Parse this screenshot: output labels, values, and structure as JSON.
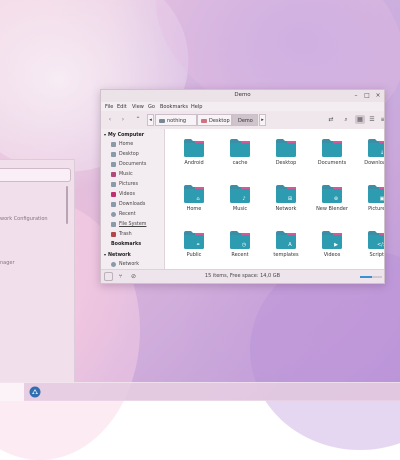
{
  "window": {
    "title": "Demo",
    "controls": {
      "minimize": "–",
      "maximize": "□",
      "close": "×"
    }
  },
  "menu": [
    "File",
    "Edit",
    "View",
    "Go",
    "Bookmarks",
    "Help"
  ],
  "breadcrumbs": [
    {
      "label": "nothing",
      "icon": "home-icon"
    },
    {
      "label": "Desktop",
      "icon": "desktop-icon"
    },
    {
      "label": "Demo",
      "icon": "folder-icon",
      "active": true
    }
  ],
  "sidebar": {
    "my_computer_label": "My Computer",
    "items": [
      {
        "label": "Home",
        "icon": "home-icon",
        "color": "#8a9aa8"
      },
      {
        "label": "Desktop",
        "icon": "desktop-icon",
        "color": "#8a9aa8"
      },
      {
        "label": "Documents",
        "icon": "documents-icon",
        "color": "#8a9aa8"
      },
      {
        "label": "Music",
        "icon": "music-icon",
        "color": "#b04a7a"
      },
      {
        "label": "Pictures",
        "icon": "pictures-icon",
        "color": "#8a9aa8"
      },
      {
        "label": "Videos",
        "icon": "videos-icon",
        "color": "#c03070"
      },
      {
        "label": "Downloads",
        "icon": "downloads-icon",
        "color": "#8a9aa8"
      },
      {
        "label": "Recent",
        "icon": "recent-icon",
        "color": "#8a9aa8"
      },
      {
        "label": "File System",
        "icon": "filesystem-icon",
        "color": "#8a9aa8"
      },
      {
        "label": "Trash",
        "icon": "trash-icon",
        "color": "#b04a4a"
      }
    ],
    "bookmarks_label": "Bookmarks",
    "network_label": "Network",
    "network_items": [
      {
        "label": "Network",
        "icon": "network-icon",
        "color": "#8a9aa8"
      }
    ]
  },
  "files": [
    {
      "name": "Android",
      "glyph": ""
    },
    {
      "name": "cache",
      "glyph": ""
    },
    {
      "name": "Desktop",
      "glyph": ""
    },
    {
      "name": "Documents",
      "glyph": ""
    },
    {
      "name": "Downloads",
      "glyph": "↓"
    },
    {
      "name": "Home",
      "glyph": "⌂"
    },
    {
      "name": "Music",
      "glyph": "♪"
    },
    {
      "name": "Network",
      "glyph": "⊞"
    },
    {
      "name": "New Blender",
      "glyph": "⊛"
    },
    {
      "name": "Pictures",
      "glyph": "▣"
    },
    {
      "name": "Public",
      "glyph": "⚭"
    },
    {
      "name": "Recent",
      "glyph": "◷"
    },
    {
      "name": "templates",
      "glyph": "A"
    },
    {
      "name": "Videos",
      "glyph": "▶"
    },
    {
      "name": "Scripts",
      "glyph": "</>"
    }
  ],
  "status": {
    "text": "15 items, Free space: 14,0 GB",
    "zoom_level": 0.55
  },
  "background_window": {
    "lines": [
      "work Configuration",
      "nager"
    ]
  },
  "colors": {
    "folder_top": "#3a8fa6",
    "folder_body": "#2e9cb0",
    "folder_tab_accent": "#d05a9a",
    "accent": "#3c8fd0"
  }
}
